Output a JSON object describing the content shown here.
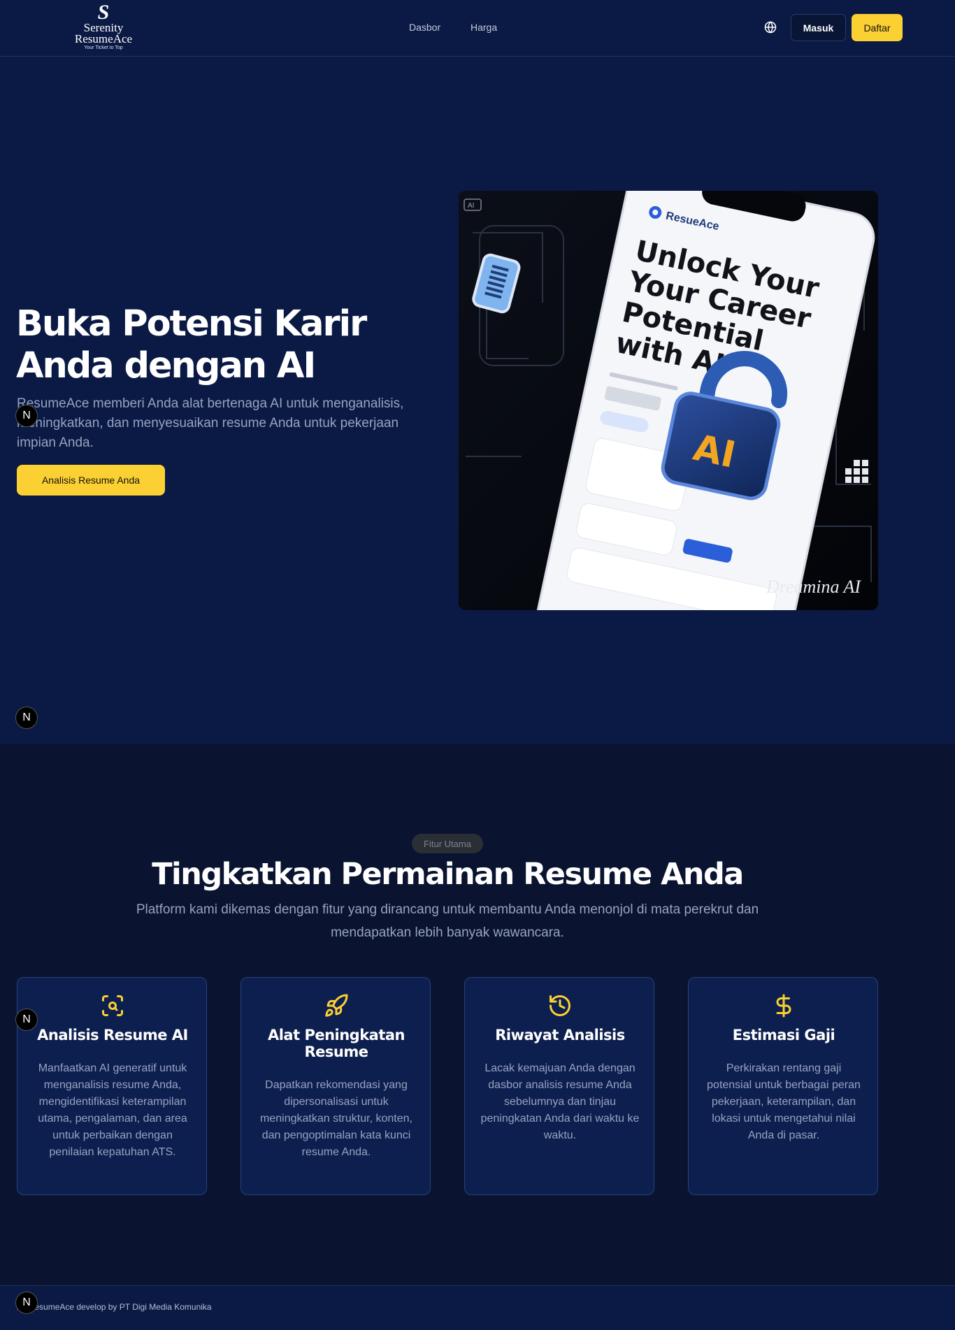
{
  "nav": {
    "logo": {
      "mark": "S",
      "line1": "Serenity",
      "line2": "ResumeAce",
      "tagline": "Your Ticket to Top"
    },
    "links": [
      "Dasbor",
      "Harga"
    ],
    "language_icon": "globe-icon",
    "login_label": "Masuk",
    "signup_label": "Daftar"
  },
  "hero": {
    "title_line1": "Buka Potensi Karir",
    "title_line2": "Anda dengan AI",
    "description": "ResumeAce memberi Anda alat bertenaga AI untuk menganalisis, meningkatkan, dan menyesuaikan resume Anda untuk pekerjaan impian Anda.",
    "cta_label": "Analisis Resume Anda",
    "image": {
      "corner_tag": "AI",
      "brand": "ResueAce",
      "headline": [
        "Unlock Your",
        "Your Career",
        "Potential",
        "with AI"
      ],
      "lock_text": "AI",
      "watermark": "Dreamina AI"
    }
  },
  "badge_letter": "N",
  "features": {
    "pill": "Fitur Utama",
    "title": "Tingkatkan Permainan Resume Anda",
    "description": "Platform kami dikemas dengan fitur yang dirancang untuk membantu Anda menonjol di mata perekrut dan mendapatkan lebih banyak wawancara.",
    "cards": [
      {
        "icon": "scan-search-icon",
        "title": "Analisis Resume AI",
        "text": "Manfaatkan AI generatif untuk menganalisis resume Anda, mengidentifikasi keterampilan utama, pengalaman, dan area untuk perbaikan dengan penilaian kepatuhan ATS."
      },
      {
        "icon": "rocket-icon",
        "title": "Alat Peningkatan Resume",
        "text": "Dapatkan rekomendasi yang dipersonalisasi untuk meningkatkan struktur, konten, dan pengoptimalan kata kunci resume Anda."
      },
      {
        "icon": "history-icon",
        "title": "Riwayat Analisis",
        "text": "Lacak kemajuan Anda dengan dasbor analisis resume Anda sebelumnya dan tinjau peningkatan Anda dari waktu ke waktu."
      },
      {
        "icon": "dollar-icon",
        "title": "Estimasi Gaji",
        "text": "Perkirakan rentang gaji potensial untuk berbagai peran pekerjaan, keterampilan, dan lokasi untuk mengetahui nilai Anda di pasar."
      }
    ]
  },
  "footer": {
    "text": "24 ResumeAce develop by PT Digi Media Komunika"
  },
  "colors": {
    "accent": "#fbd032",
    "bg": "#0b1a44",
    "section_bg": "#0a1431",
    "card_bg": "#0d1f4f"
  }
}
